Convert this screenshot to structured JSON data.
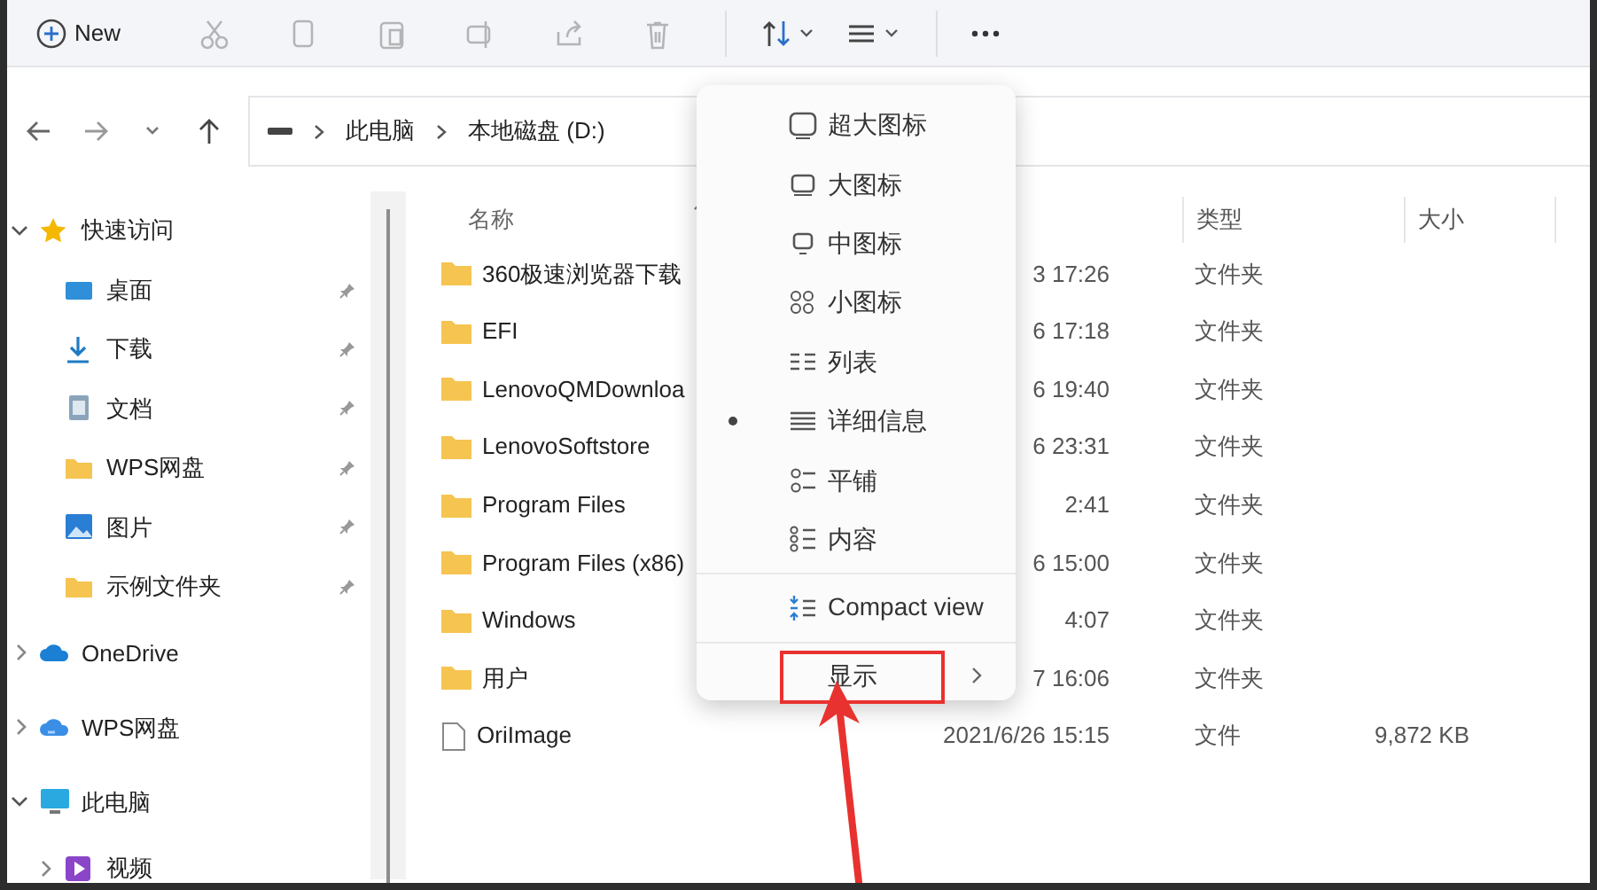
{
  "toolbar": {
    "new_button": {
      "label": "New"
    },
    "actions": [
      {
        "kind": "cut",
        "disabled": true
      },
      {
        "kind": "copy",
        "disabled": true
      },
      {
        "kind": "paste",
        "disabled": true
      },
      {
        "kind": "rename",
        "disabled": true
      },
      {
        "kind": "share",
        "disabled": true
      },
      {
        "kind": "delete",
        "disabled": true
      }
    ],
    "menus": [
      {
        "kind": "sort"
      },
      {
        "kind": "view"
      }
    ]
  },
  "address": {
    "segments": [
      "此电脑",
      "本地磁盘 (D:)"
    ]
  },
  "sidebar": {
    "items": [
      {
        "label": "快速访问",
        "kind": "star",
        "expanded": true,
        "children": [
          {
            "label": "桌面",
            "kind": "desktop",
            "pinned": true
          },
          {
            "label": "下载",
            "kind": "download",
            "pinned": true
          },
          {
            "label": "文档",
            "kind": "document",
            "pinned": true
          },
          {
            "label": "WPS网盘",
            "kind": "folder",
            "pinned": true
          },
          {
            "label": "图片",
            "kind": "picture",
            "pinned": true
          },
          {
            "label": "示例文件夹",
            "kind": "folder",
            "pinned": true
          }
        ]
      },
      {
        "label": "OneDrive",
        "kind": "cloud",
        "expanded": false
      },
      {
        "label": "WPS网盘",
        "kind": "cloud2",
        "expanded": false
      },
      {
        "label": "此电脑",
        "kind": "pc",
        "expanded": true,
        "children": [
          {
            "label": "视频",
            "kind": "video",
            "expanded": false
          }
        ]
      }
    ]
  },
  "table": {
    "columns": [
      {
        "label": "名称",
        "sorted": true
      },
      {
        "label": "类型"
      },
      {
        "label": "大小"
      }
    ],
    "rows": [
      {
        "kind": "folder",
        "name": "360极速浏览器下载",
        "modified": "3 17:26",
        "type": "文件夹"
      },
      {
        "kind": "folder",
        "name": "EFI",
        "modified": "6 17:18",
        "type": "文件夹"
      },
      {
        "kind": "folder",
        "name": "LenovoQMDownloa",
        "modified": "6 19:40",
        "type": "文件夹"
      },
      {
        "kind": "folder",
        "name": "LenovoSoftstore",
        "modified": "6 23:31",
        "type": "文件夹"
      },
      {
        "kind": "folder",
        "name": "Program Files",
        "modified": "2:41",
        "type": "文件夹"
      },
      {
        "kind": "folder",
        "name": "Program Files (x86)",
        "modified": "6 15:00",
        "type": "文件夹"
      },
      {
        "kind": "folder",
        "name": "Windows",
        "modified": "4:07",
        "type": "文件夹"
      },
      {
        "kind": "folder",
        "name": "用户",
        "modified": "7 16:06",
        "type": "文件夹"
      },
      {
        "kind": "file",
        "name": "OriImage",
        "modified": "2021/6/26 15:15",
        "type": "文件",
        "size": "9,872 KB"
      }
    ]
  },
  "view_menu": {
    "items": [
      {
        "kind": "xlarge",
        "label": "超大图标",
        "selected": false
      },
      {
        "kind": "large",
        "label": "大图标",
        "selected": false
      },
      {
        "kind": "medium",
        "label": "中图标",
        "selected": false
      },
      {
        "kind": "small",
        "label": "小图标",
        "selected": false
      },
      {
        "kind": "list",
        "label": "列表",
        "selected": false
      },
      {
        "kind": "details",
        "label": "详细信息",
        "selected": true
      },
      {
        "kind": "tiles",
        "label": "平铺",
        "selected": false
      },
      {
        "kind": "content",
        "label": "内容",
        "selected": false
      },
      {
        "kind": "compact",
        "label": "Compact view"
      },
      {
        "kind": "submenu",
        "label": "显示",
        "annotated": true
      }
    ]
  }
}
